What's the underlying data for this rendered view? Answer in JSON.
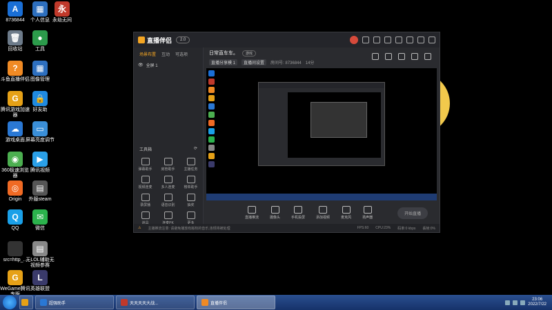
{
  "desktop": {
    "icons": [
      {
        "label": "8736844",
        "color": "#1a6fd6",
        "glyph": "A"
      },
      {
        "label": "个人信息",
        "color": "#2d6fbf",
        "glyph": "▦"
      },
      {
        "label": "永劫无间",
        "color": "#c0392b",
        "glyph": "永"
      },
      {
        "label": "回收站",
        "color": "#6d7b8a",
        "glyph": "🗑"
      },
      {
        "label": "工具",
        "color": "#2c9b4b",
        "glyph": "●"
      },
      {
        "label": "斗鱼直播伴侣",
        "color": "#f08a24",
        "glyph": "?"
      },
      {
        "label": "图像管理",
        "color": "#2d6fbf",
        "glyph": "▦"
      },
      {
        "label": "腾讯游戏加速器",
        "color": "#e6a117",
        "glyph": "G"
      },
      {
        "label": "好友助",
        "color": "#1f8ae0",
        "glyph": "🔒"
      },
      {
        "label": "游戏桌面",
        "color": "#2a78d4",
        "glyph": "☁"
      },
      {
        "label": "屏幕亮度调节",
        "color": "#3a8fd8",
        "glyph": "▭"
      },
      {
        "label": "360极速浏览器",
        "color": "#4caf50",
        "glyph": "◉"
      },
      {
        "label": "腾讯视频",
        "color": "#2aa0e8",
        "glyph": "▶"
      },
      {
        "label": "Origin",
        "color": "#f06a24",
        "glyph": "◎"
      },
      {
        "label": "外服steam",
        "color": "#555",
        "glyph": "▤"
      },
      {
        "label": "QQ",
        "color": "#1aa0e8",
        "glyph": "Q"
      },
      {
        "label": "微信",
        "color": "#2bb24c",
        "glyph": "✉"
      },
      {
        "label": "src=http_...",
        "color": "#333",
        "glyph": ""
      },
      {
        "label": "无LOL辅助无视频参赛",
        "color": "#888",
        "glyph": "▤"
      },
      {
        "label": "WeGame腾讯专版",
        "color": "#e6a117",
        "glyph": "G"
      },
      {
        "label": "英雄联盟",
        "color": "#3a3a6a",
        "glyph": "L"
      }
    ]
  },
  "app": {
    "name": "直播伴侣",
    "version_pill": "2.0",
    "left_tabs": [
      "场景布置",
      "互动",
      "可选项"
    ],
    "scene_label": "全屏 1",
    "tools_header": "工具箱",
    "tools": [
      "弹幕助手",
      "房管助手",
      "主播任务",
      "视频连麦",
      "多人连麦",
      "榜单助手",
      "录屏播",
      "语音识别",
      "抽奖",
      "道具",
      "连麦PK",
      "更多"
    ],
    "room_title": "日常直车车。",
    "room_tag": "游戏",
    "category": "直播分享模 1",
    "category2": "直播间设置",
    "room_id_label": "房间号: 8736844",
    "viewers": "14分",
    "controls": [
      "直播推流",
      "摄像头",
      "手机投屏",
      "添加视频",
      "麦克风",
      "扬声器"
    ],
    "go_live": "开始直播",
    "status_warn": "主播推流注意: 请避免播放有版权的音乐,违规将被处理",
    "status_stats": [
      "FPS:60",
      "CPU:23%",
      "码率:0 kbps",
      "丢帧:0%"
    ]
  },
  "taskbar": {
    "tasks": [
      {
        "label": "超强助手",
        "color": "#2a78d4"
      },
      {
        "label": "天天天天大战...",
        "color": "#c0392b"
      },
      {
        "label": "直播伴侣",
        "color": "#f08a24"
      }
    ],
    "time": "23:06",
    "date": "2022/7/22"
  }
}
